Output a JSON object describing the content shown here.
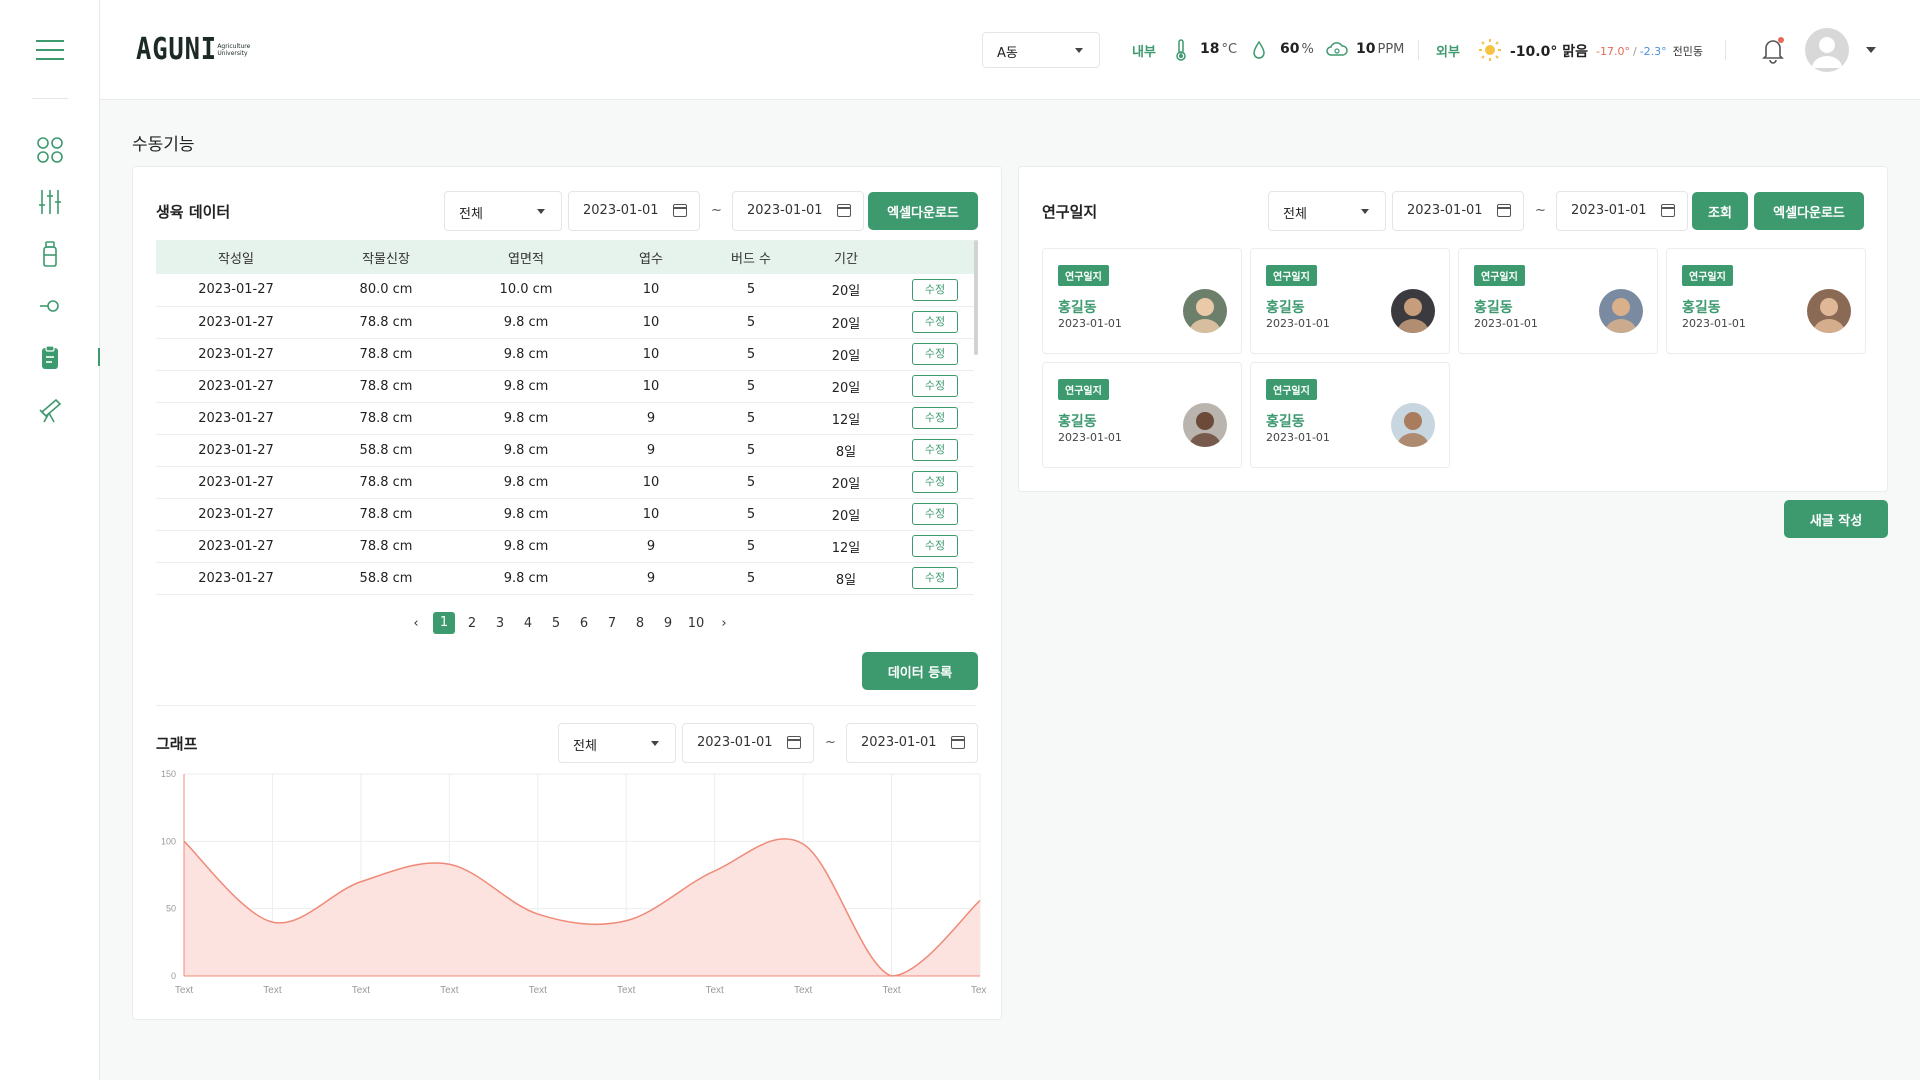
{
  "header": {
    "logo_text": "AGUNI",
    "logo_sub_1": "Agriculture",
    "logo_sub_2": "University",
    "building_select": "A동",
    "inside_label": "내부",
    "temp_value": "18",
    "temp_unit": "°C",
    "humidity_value": "60",
    "humidity_unit": "%",
    "co2_value": "10",
    "co2_unit": "PPM",
    "outside_label": "외부",
    "weather_value": "-10.0° 맑음",
    "weather_min": "-17.0°",
    "weather_slash": "/",
    "weather_max": "-2.3°",
    "weather_location": "전민동",
    "accent": "#3d9a6f"
  },
  "sidebar": {
    "icons": [
      "dashboard-icon",
      "sliders-icon",
      "bottle-icon",
      "sensor-icon",
      "clipboard-icon",
      "telescope-icon"
    ],
    "active": "clipboard-icon"
  },
  "page": {
    "title": "수동기능"
  },
  "growth": {
    "title": "생육 데이터",
    "filter": "전체",
    "date_from": "2023-01-01",
    "tilde": "~",
    "date_to": "2023-01-01",
    "excel_btn": "엑셀다운로드",
    "columns": [
      "작성일",
      "작물신장",
      "엽면적",
      "엽수",
      "버드 수",
      "기간",
      ""
    ],
    "rows": [
      [
        "2023-01-27",
        "80.0 cm",
        "10.0 cm",
        "10",
        "5",
        "20일"
      ],
      [
        "2023-01-27",
        "78.8 cm",
        "9.8 cm",
        "10",
        "5",
        "20일"
      ],
      [
        "2023-01-27",
        "78.8 cm",
        "9.8 cm",
        "10",
        "5",
        "20일"
      ],
      [
        "2023-01-27",
        "78.8 cm",
        "9.8 cm",
        "10",
        "5",
        "20일"
      ],
      [
        "2023-01-27",
        "78.8 cm",
        "9.8 cm",
        "9",
        "5",
        "12일"
      ],
      [
        "2023-01-27",
        "58.8 cm",
        "9.8 cm",
        "9",
        "5",
        "8일"
      ],
      [
        "2023-01-27",
        "78.8 cm",
        "9.8 cm",
        "10",
        "5",
        "20일"
      ],
      [
        "2023-01-27",
        "78.8 cm",
        "9.8 cm",
        "10",
        "5",
        "20일"
      ],
      [
        "2023-01-27",
        "78.8 cm",
        "9.8 cm",
        "9",
        "5",
        "12일"
      ],
      [
        "2023-01-27",
        "58.8 cm",
        "9.8 cm",
        "9",
        "5",
        "8일"
      ]
    ],
    "edit_label": "수정",
    "pages": [
      "1",
      "2",
      "3",
      "4",
      "5",
      "6",
      "7",
      "8",
      "9",
      "10"
    ],
    "current_page": "1",
    "prev": "‹",
    "next": "›",
    "register_btn": "데이터 등록"
  },
  "graph": {
    "title": "그래프",
    "filter": "전체",
    "date_from": "2023-01-01",
    "tilde": "~",
    "date_to": "2023-01-01"
  },
  "chart_data": {
    "type": "area",
    "categories": [
      "Text",
      "Text",
      "Text",
      "Text",
      "Text",
      "Text",
      "Text",
      "Text",
      "Text",
      "Text"
    ],
    "series": [
      {
        "values": [
          100,
          40,
          70,
          83,
          46,
          41,
          78,
          98,
          0,
          56
        ]
      }
    ],
    "ylim": [
      0,
      150
    ],
    "yticks": [
      0,
      50,
      100,
      150
    ],
    "grid": true,
    "color": "#f08a78",
    "fill": "#fde3df"
  },
  "diary": {
    "title": "연구일지",
    "filter": "전체",
    "date_from": "2023-01-01",
    "tilde": "~",
    "date_to": "2023-01-01",
    "search_btn": "조회",
    "excel_btn": "엑셀다운로드",
    "new_btn": "새글 작성",
    "cards": [
      {
        "tag": "연구일지",
        "name": "홍길동",
        "date": "2023-01-01",
        "photo": "avatar-1"
      },
      {
        "tag": "연구일지",
        "name": "홍길동",
        "date": "2023-01-01",
        "photo": "avatar-2"
      },
      {
        "tag": "연구일지",
        "name": "홍길동",
        "date": "2023-01-01",
        "photo": "avatar-3"
      },
      {
        "tag": "연구일지",
        "name": "홍길동",
        "date": "2023-01-01",
        "photo": "avatar-4"
      },
      {
        "tag": "연구일지",
        "name": "홍길동",
        "date": "2023-01-01",
        "photo": "avatar-5"
      },
      {
        "tag": "연구일지",
        "name": "홍길동",
        "date": "2023-01-01",
        "photo": "avatar-6"
      }
    ]
  }
}
